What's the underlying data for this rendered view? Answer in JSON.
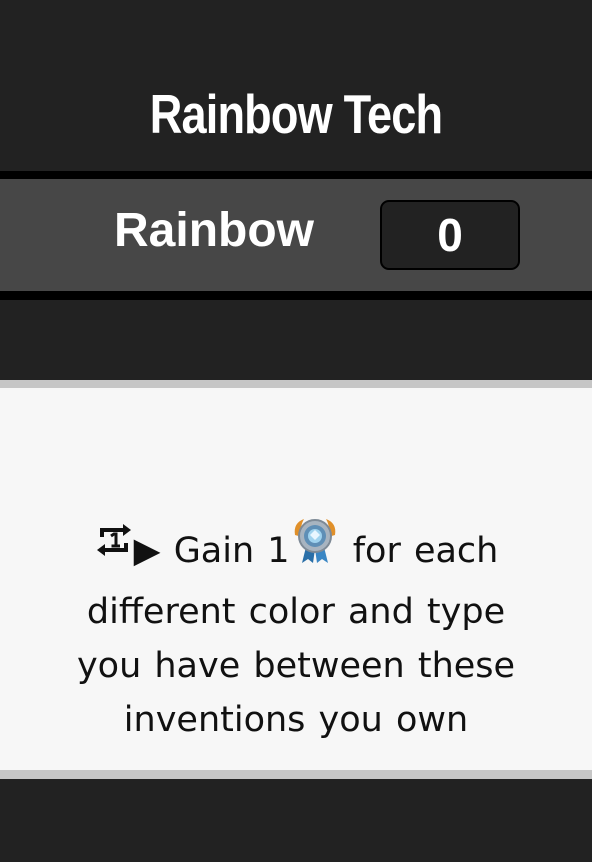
{
  "card": {
    "title": "Rainbow Tech",
    "counter": {
      "label": "Rainbow",
      "value": "0"
    },
    "ability": {
      "trigger_icon": "repeat-once-icon",
      "arrow": "▶",
      "text_before_icon": "Gain 1",
      "resource_icon": "medal-icon",
      "text_after_icon": "for each different color and type you have between these inventions you own"
    }
  },
  "colors": {
    "background": "#222222",
    "counter_row": "#474747",
    "card_face": "#f7f7f7",
    "card_border": "#c6c6c6"
  }
}
